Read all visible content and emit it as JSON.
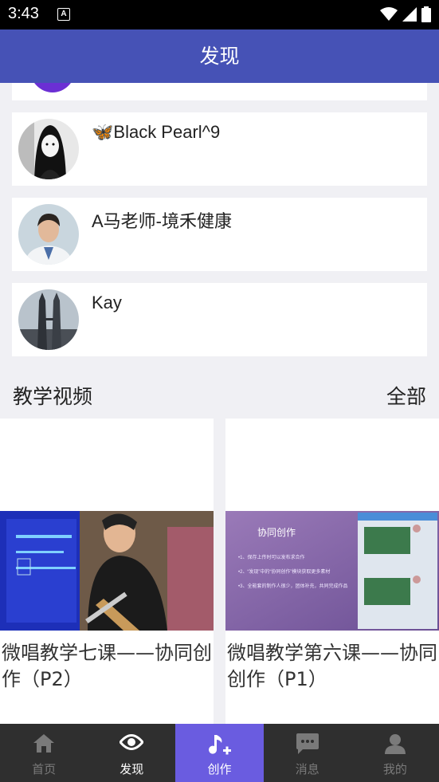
{
  "status": {
    "time": "3:43"
  },
  "appbar": {
    "title": "发现"
  },
  "users": [
    {
      "name": "🦋Black Pearl^9",
      "avatar": "avatar-girl-sketch"
    },
    {
      "name": "A马老师-境禾健康",
      "avatar": "avatar-doctor"
    },
    {
      "name": "Kay",
      "avatar": "avatar-towers"
    }
  ],
  "section": {
    "title": "教学视频",
    "all": "全部"
  },
  "videos": [
    {
      "title": "微唱教学七课——协同创作（P2）"
    },
    {
      "title": "微唱教学第六课——协同创作（P1）"
    }
  ],
  "slide": {
    "title": "协同创作",
    "lines": [
      "•1、保存上传时可以发布求合作",
      "•2、“发现”中的“协同创作”模块获取更多素材",
      "•3、全能套的制作人很少，团体补充，共同完成作品"
    ]
  },
  "nav": [
    {
      "label": "首页",
      "icon": "home-icon"
    },
    {
      "label": "发现",
      "icon": "eye-icon"
    },
    {
      "label": "创作",
      "icon": "music-note-plus-icon"
    },
    {
      "label": "消息",
      "icon": "chat-icon"
    },
    {
      "label": "我的",
      "icon": "person-icon"
    }
  ],
  "colors": {
    "appbar": "#4652b6",
    "nav_active": "#6a5ce0",
    "nav_bg": "#2f2f2f"
  }
}
